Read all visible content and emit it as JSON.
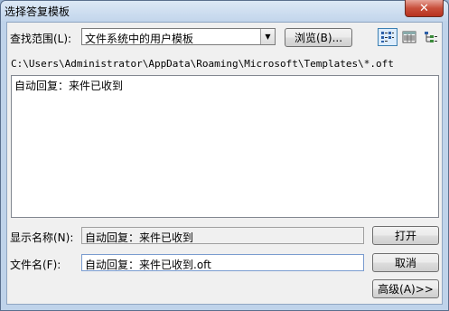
{
  "window": {
    "title": "选择答复模板",
    "close_glyph": "✕"
  },
  "look_in": {
    "label": "查找范围(L):",
    "selected": "文件系统中的用户模板",
    "browse_label": "浏览(B)..."
  },
  "view_buttons": [
    {
      "name": "list-view-icon",
      "active": true
    },
    {
      "name": "details-view-icon",
      "active": false
    },
    {
      "name": "tree-view-icon",
      "active": false
    }
  ],
  "path": "C:\\Users\\Administrator\\AppData\\Roaming\\Microsoft\\Templates\\*.oft",
  "files": [
    "自动回复：来件已收到"
  ],
  "display_name": {
    "label": "显示名称(N):",
    "value": "自动回复：来件已收到"
  },
  "file_name": {
    "label": "文件名(F):",
    "value": "自动回复：来件已收到.oft"
  },
  "buttons": {
    "open": "打开",
    "cancel": "取消",
    "advanced": "高级(A)>>"
  }
}
